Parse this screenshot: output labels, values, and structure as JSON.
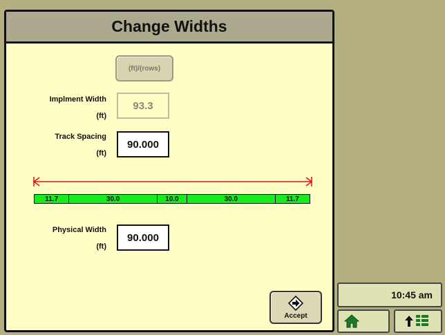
{
  "dialog": {
    "title": "Change Widths",
    "units_button_label": "(ft)/(rows)",
    "implement_width": {
      "label": "Implment Width",
      "unit": "(ft)",
      "value": "93.3"
    },
    "track_spacing": {
      "label": "Track Spacing",
      "unit": "(ft)",
      "value": "90.000"
    },
    "segments": [
      {
        "label": "11.7",
        "value": 11.7
      },
      {
        "label": "30.0",
        "value": 30.0
      },
      {
        "label": "10.0",
        "value": 10.0
      },
      {
        "label": "30.0",
        "value": 30.0
      },
      {
        "label": "11.7",
        "value": 11.7
      }
    ],
    "physical_width": {
      "label": "Physical Width",
      "unit": "(ft)",
      "value": "90.000"
    },
    "accept_label": "Accept"
  },
  "status": {
    "time": "10:45 am"
  },
  "icons": {
    "accept": "arrow-right-diamond-icon",
    "home": "home-icon",
    "menu": "up-arrow-grid-icon"
  },
  "colors": {
    "background": "#b3af80",
    "dialog_body": "#fefec5",
    "title_bar": "#aca98e",
    "segment_fill": "#17ea1d",
    "arrow": "#e01010",
    "icon_green": "#1b7a2a"
  }
}
